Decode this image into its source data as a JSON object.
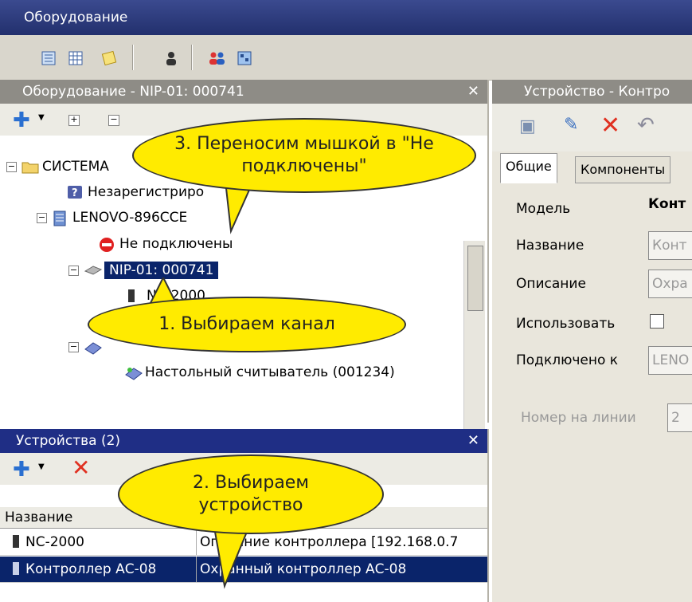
{
  "main_window": {
    "title": "Оборудование"
  },
  "main_toolbar": {
    "icons": [
      "tree-view-icon",
      "grid-icon",
      "note-icon",
      "user-icon",
      "users-icon",
      "map-icon"
    ]
  },
  "tree_panel": {
    "title": "Оборудование - NIP-01: 000741",
    "items": [
      {
        "label": "СИСТЕМА"
      },
      {
        "label": "Незарегистриро"
      },
      {
        "label": "LENOVO-896CCE"
      },
      {
        "label": "Не подключены"
      },
      {
        "label": "NIP-01: 000741"
      },
      {
        "label": "NC-2000"
      },
      {
        "label": "Настольный считыватель (001234)"
      }
    ]
  },
  "devices_panel": {
    "title": "Устройства (2)",
    "columns": [
      "Название"
    ],
    "rows": [
      {
        "name": "NC-2000",
        "description": "Описание контроллера [192.168.0.7"
      },
      {
        "name": "Контроллер АС-08",
        "description": "Охранный контроллер АС-08"
      }
    ]
  },
  "properties_panel": {
    "title": "Устройство - Контро",
    "tabs": [
      "Общие",
      "Компоненты"
    ],
    "fields": {
      "model_label": "Модель",
      "model_value": "Конт",
      "name_label": "Название",
      "name_value": "Конт",
      "desc_label": "Описание",
      "desc_value": "Охра",
      "use_label": "Использовать",
      "connected_label": "Подключено к",
      "connected_value": "LENO",
      "line_label": "Номер на линии",
      "line_value": "2"
    }
  },
  "callouts": {
    "step3": "3. Переносим мышкой в \"Не подключены\"",
    "step1": "1. Выбираем канал",
    "step2": "2. Выбираем устройство"
  },
  "colors": {
    "selection": "#0a246a",
    "callout": "#ffeb00",
    "title_active": "#1f2e85"
  }
}
